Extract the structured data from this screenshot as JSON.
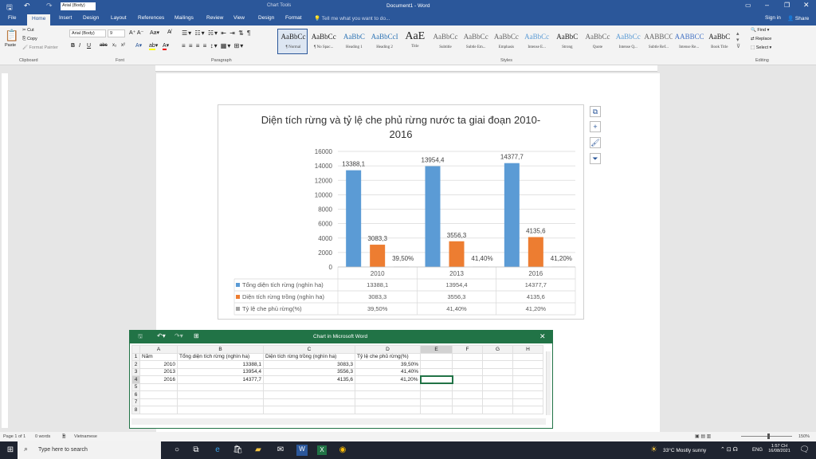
{
  "window": {
    "title": "Document1 - Word",
    "chart_tools": "Chart Tools",
    "font_box": "Arial (Body)",
    "signin": "Sign in",
    "share": "Share"
  },
  "tabs": [
    "File",
    "Home",
    "Insert",
    "Design",
    "Layout",
    "References",
    "Mailings",
    "Review",
    "View",
    "Design",
    "Format"
  ],
  "tellme": "Tell me what you want to do...",
  "ribbon": {
    "clipboard": {
      "paste": "Paste",
      "cut": "Cut",
      "copy": "Copy",
      "format_painter": "Format Painter",
      "group": "Clipboard"
    },
    "font": {
      "name": "Arial (Body)",
      "size": "9",
      "group": "Font"
    },
    "paragraph_group": "Paragraph",
    "styles_group": "Styles",
    "editing": {
      "find": "Find",
      "replace": "Replace",
      "select": "Select",
      "group": "Editing"
    },
    "styles": [
      {
        "sample": "AaBbCc",
        "name": "¶ Normal"
      },
      {
        "sample": "AaBbCc",
        "name": "¶ No Spac..."
      },
      {
        "sample": "AaBbC",
        "name": "Heading 1"
      },
      {
        "sample": "AaBbCcI",
        "name": "Heading 2"
      },
      {
        "sample": "AaE",
        "name": "Title"
      },
      {
        "sample": "AaBbCc",
        "name": "Subtitle"
      },
      {
        "sample": "AaBbCc",
        "name": "Subtle Em..."
      },
      {
        "sample": "AaBbCc",
        "name": "Emphasis"
      },
      {
        "sample": "AaBbCc",
        "name": "Intense E..."
      },
      {
        "sample": "AaBbC",
        "name": "Strong"
      },
      {
        "sample": "AaBbCc",
        "name": "Quote"
      },
      {
        "sample": "AaBbCc",
        "name": "Intense Q..."
      },
      {
        "sample": "AABBCC",
        "name": "Subtle Ref..."
      },
      {
        "sample": "AABBCC",
        "name": "Intense Re..."
      },
      {
        "sample": "AaBbC",
        "name": "Book Title"
      }
    ]
  },
  "chart_data": {
    "type": "bar",
    "title": "Diện tích rừng và tỷ lệ che phủ rừng nước ta giai đoạn 2010-2016",
    "categories": [
      "2010",
      "2013",
      "2016"
    ],
    "ylim": [
      0,
      16000
    ],
    "yticks": [
      "16000",
      "14000",
      "12000",
      "10000",
      "8000",
      "6000",
      "4000",
      "2000",
      "0"
    ],
    "series": [
      {
        "name": "Tổng diện tích rừng (nghìn ha)",
        "values": [
          13388.1,
          13954.4,
          14377.7
        ],
        "labels": [
          "13388,1",
          "13954,4",
          "14377,7"
        ],
        "color": "#5b9bd5"
      },
      {
        "name": "Diện tích rừng trồng (nghìn ha)",
        "values": [
          3083.3,
          3556.3,
          4135.6
        ],
        "labels": [
          "3083,3",
          "3556,3",
          "4135,6"
        ],
        "color": "#ed7d31"
      },
      {
        "name": "Tỷ lệ che phủ rừng(%)",
        "values": [
          39.5,
          41.4,
          41.2
        ],
        "labels": [
          "39,50%",
          "41,40%",
          "41,20%"
        ],
        "color": "#a5a5a5"
      }
    ],
    "grid": true,
    "legend": "data table below"
  },
  "excel": {
    "title": "Chart in Microsoft Word",
    "cols": [
      "A",
      "B",
      "C",
      "D",
      "E",
      "F",
      "G",
      "H"
    ],
    "rows": [
      [
        "Năm",
        "Tổng diện tích rừng (nghìn ha)",
        "Diện tích rừng trồng (nghìn ha)",
        "Tỷ lệ che phủ rừng(%)",
        "",
        "",
        "",
        ""
      ],
      [
        "2010",
        "13388,1",
        "3083,3",
        "39,50%",
        "",
        "",
        "",
        ""
      ],
      [
        "2013",
        "13954,4",
        "3556,3",
        "41,40%",
        "",
        "",
        "",
        ""
      ],
      [
        "2016",
        "14377,7",
        "4135,6",
        "41,20%",
        "",
        "",
        "",
        ""
      ],
      [
        "",
        "",
        "",
        "",
        "",
        "",
        "",
        ""
      ],
      [
        "",
        "",
        "",
        "",
        "",
        "",
        "",
        ""
      ],
      [
        "",
        "",
        "",
        "",
        "",
        "",
        "",
        ""
      ],
      [
        "",
        "",
        "",
        "",
        "",
        "",
        "",
        ""
      ]
    ]
  },
  "status": {
    "page": "Page 1 of 1",
    "words": "0 words",
    "lang": "Vietnamese",
    "zoom": "150%"
  },
  "taskbar": {
    "search": "Type here to search",
    "weather": "33°C  Mostly sunny",
    "lang": "ENG",
    "time": "1:57 CH",
    "date": "16/08/2021"
  }
}
